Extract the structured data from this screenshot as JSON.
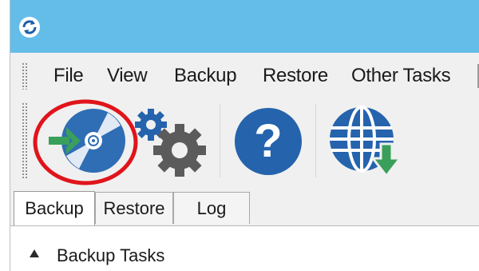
{
  "menu": {
    "items": [
      "File",
      "View",
      "Backup",
      "Restore",
      "Other Tasks"
    ]
  },
  "toolbar": {
    "buttons": [
      {
        "icon": "backup-disc-icon"
      },
      {
        "icon": "settings-gears-icon"
      },
      {
        "icon": "help-icon"
      },
      {
        "icon": "web-download-icon"
      }
    ],
    "highlight_color": "#e0141b"
  },
  "tabs": [
    "Backup",
    "Restore",
    "Log"
  ],
  "tree": {
    "nodes": [
      {
        "label": "Backup Tasks",
        "expanded": true
      }
    ]
  },
  "colors": {
    "titlebar": "#64bde9",
    "disc_blue": "#2f6db5",
    "arrow_green": "#3a9f5a",
    "gear_gray": "#5b5b5b",
    "gear_blue": "#2563ad"
  }
}
